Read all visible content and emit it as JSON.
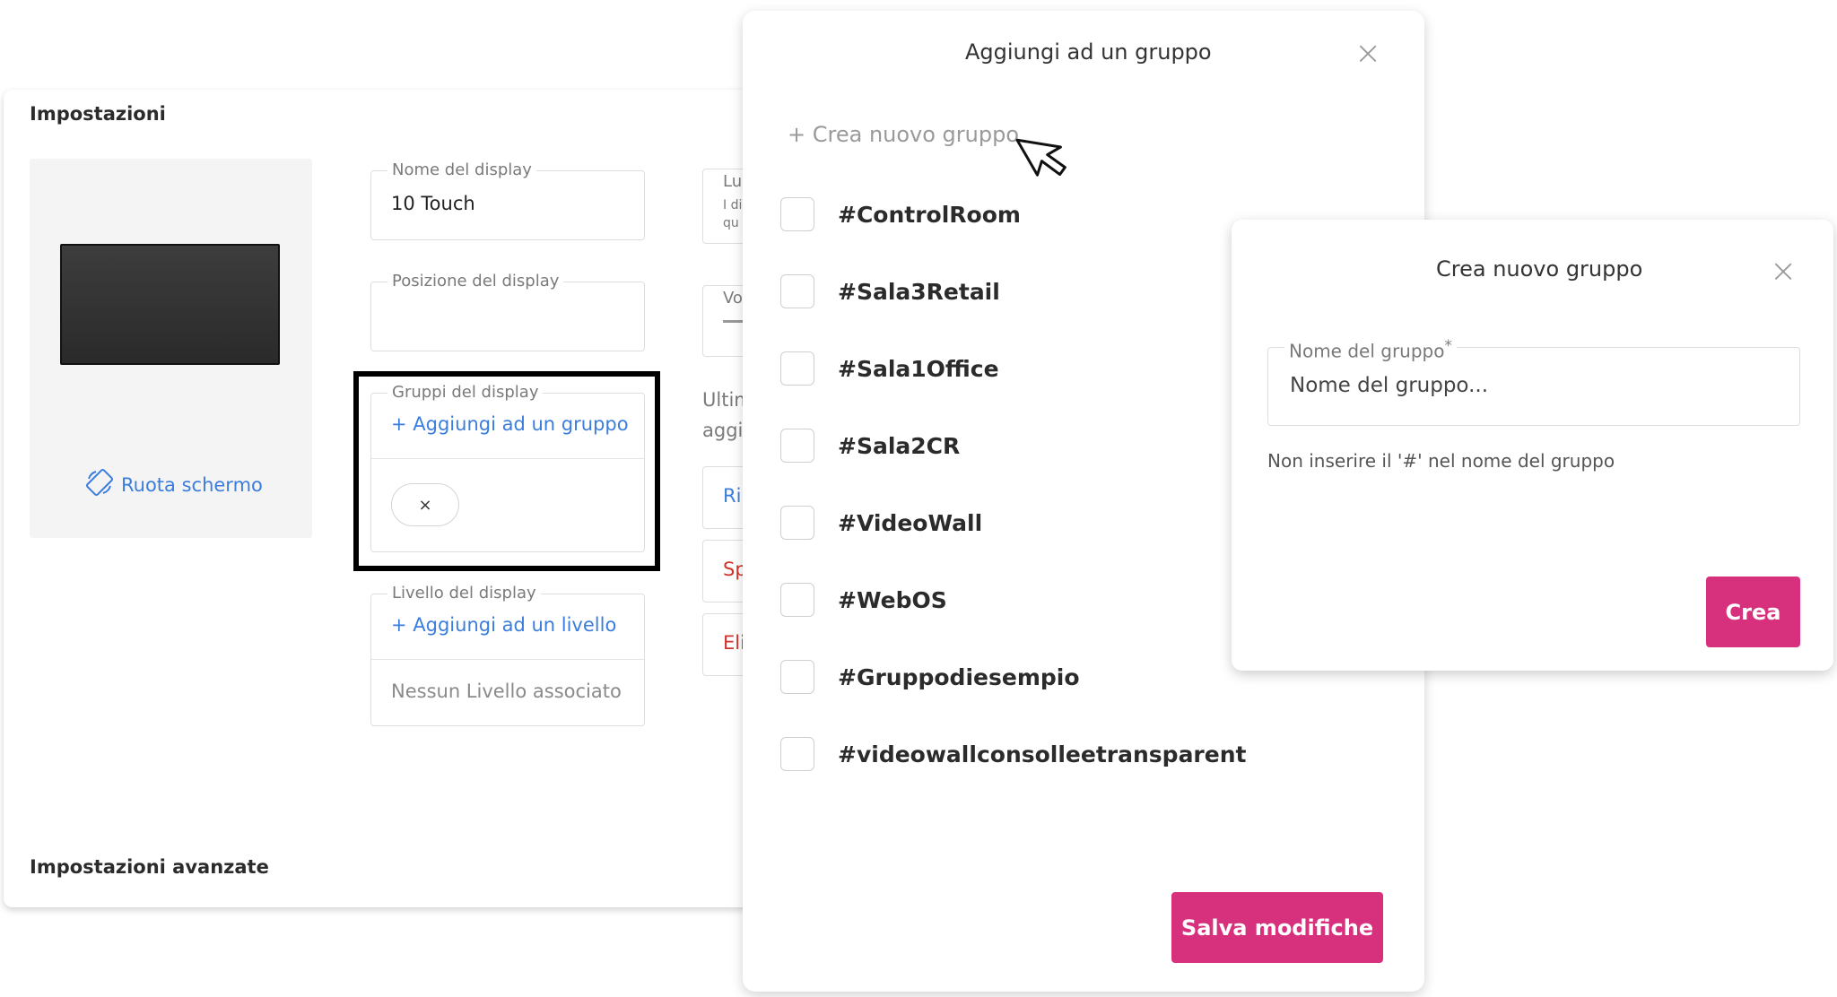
{
  "settings": {
    "title": "Impostazioni",
    "advanced_title": "Impostazioni avanzate",
    "rotate_label": "Ruota schermo",
    "display_name": {
      "label": "Nome del display",
      "value": "10 Touch"
    },
    "display_position": {
      "label": "Posizione del display",
      "value": ""
    },
    "display_groups": {
      "label": "Gruppi del display",
      "add_link": "+ Aggiungi ad un gruppo",
      "chip_close": "×"
    },
    "display_level": {
      "label": "Livello del display",
      "add_link": "+ Aggiungi ad un livello",
      "empty": "Nessun Livello associato"
    },
    "partial": {
      "lu": "Lu",
      "idi": "I di",
      "qu": "qu",
      "vo": "Vo",
      "ultim": "Ultim",
      "aggi": "aggi",
      "ri": "Ri",
      "sp": "Sp",
      "eli": "Eli"
    }
  },
  "group_modal": {
    "title": "Aggiungi ad un gruppo",
    "close": "×",
    "create_link": "+ Crea nuovo gruppo",
    "groups": [
      "#ControlRoom",
      "#Sala3Retail",
      "#Sala1Office",
      "#Sala2CR",
      "#VideoWall",
      "#WebOS",
      "#Gruppodiesempio",
      "#videowallconsolleetransparent"
    ],
    "save_label": "Salva modifiche"
  },
  "create_modal": {
    "title": "Crea nuovo gruppo",
    "close": "×",
    "field_label": "Nome del gruppo",
    "required_mark": "*",
    "placeholder": "Nome del gruppo...",
    "hint": "Non inserire il '#' nel nome del gruppo",
    "create_label": "Crea"
  },
  "colors": {
    "accent": "#d7317e",
    "link": "#3b7ddd",
    "danger": "#d0342c"
  },
  "icons": {
    "rotate": "rotate-screen-icon",
    "close": "close-icon",
    "cursor": "mouse-pointer-icon"
  }
}
